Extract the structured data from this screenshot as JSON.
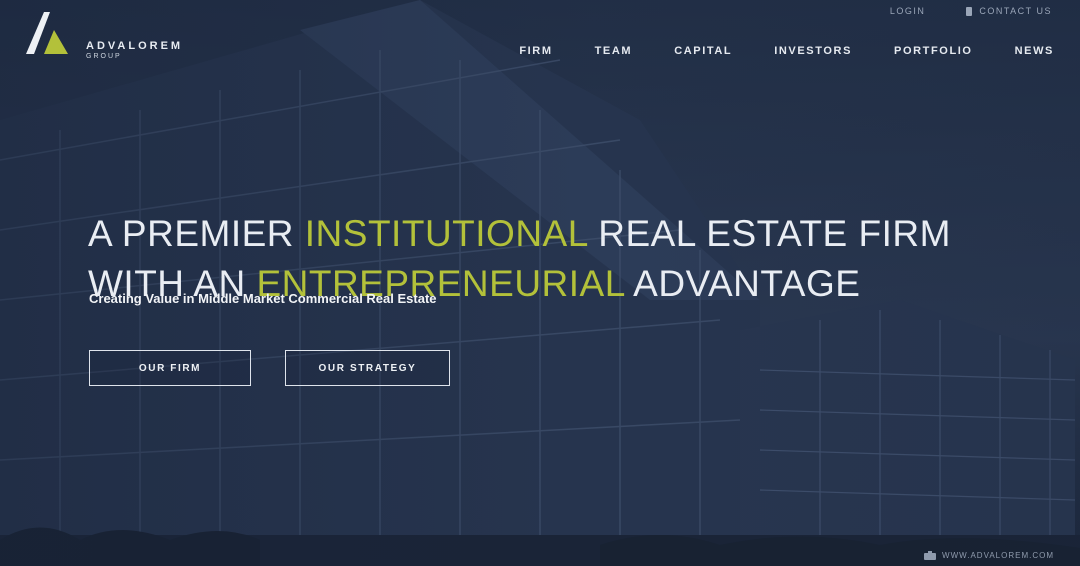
{
  "brand": {
    "name": "ADVALOREM",
    "sub": "GROUP",
    "icon": "logo-a-mark"
  },
  "utility": {
    "login": "LOGIN",
    "contact": "CONTACT US",
    "contact_icon": "phone-icon"
  },
  "nav": {
    "items": [
      "FIRM",
      "TEAM",
      "CAPITAL",
      "INVESTORS",
      "PORTFOLIO",
      "NEWS"
    ]
  },
  "hero": {
    "line1": {
      "pre": "A PREMIER ",
      "highlight": "INSTITUTIONAL",
      "post": " REAL ESTATE FIRM"
    },
    "line2": {
      "pre": "WITH AN ",
      "highlight": "ENTREPRENEURIAL",
      "post": " ADVANTAGE"
    },
    "subhead": "Creating Value in Middle Market Commercial Real Estate",
    "buttons": {
      "firm": "OUR FIRM",
      "strategy": "OUR STRATEGY"
    }
  },
  "footer": {
    "url": "WWW.ADVALOREM.COM",
    "icon": "camera-icon"
  },
  "colors": {
    "accent": "#b3c13a",
    "overlay": "#1f2d44",
    "text": "#e9edf3"
  }
}
